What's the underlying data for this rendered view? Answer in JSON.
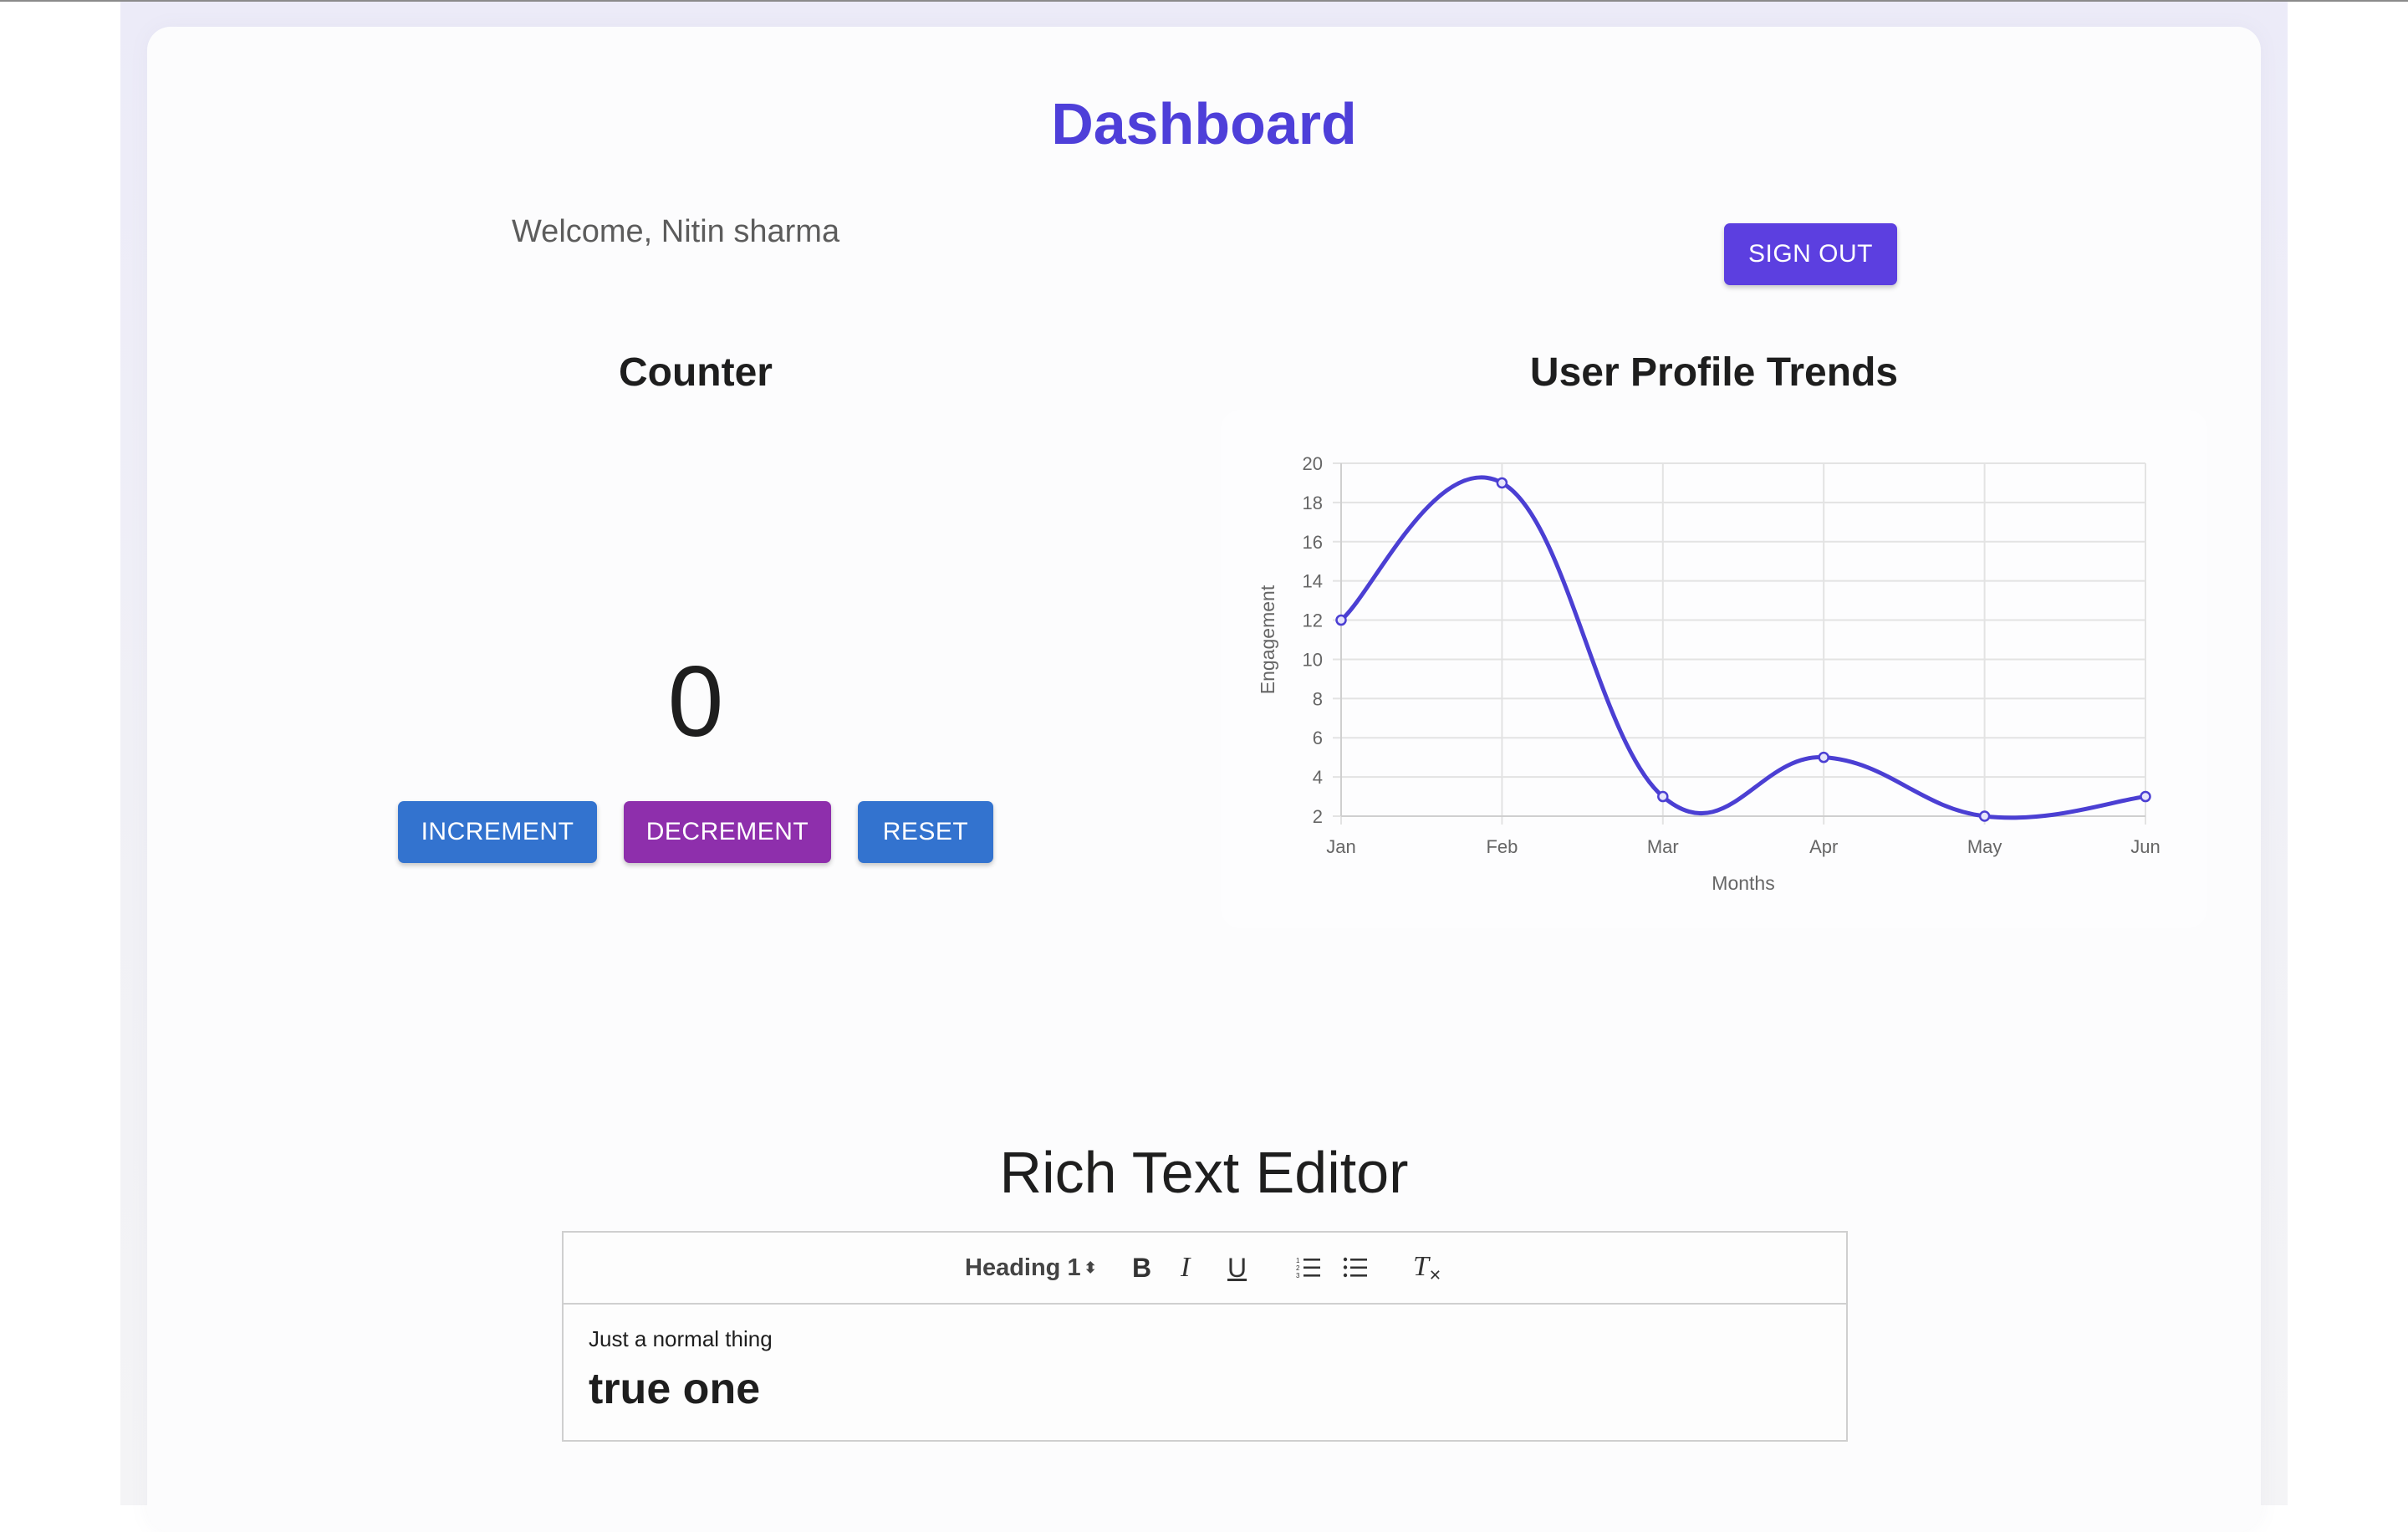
{
  "header": {
    "title": "Dashboard"
  },
  "welcome": {
    "text": "Welcome, Nitin sharma"
  },
  "buttons": {
    "sign_out": "SIGN OUT"
  },
  "counter": {
    "title": "Counter",
    "value": "0",
    "increment_label": "INCREMENT",
    "decrement_label": "DECREMENT",
    "reset_label": "RESET"
  },
  "chart_title": "User Profile Trends",
  "chart_data": {
    "type": "line",
    "categories": [
      "Jan",
      "Feb",
      "Mar",
      "Apr",
      "May",
      "Jun"
    ],
    "series": [
      {
        "values": [
          12,
          19,
          3,
          5,
          2,
          3
        ]
      }
    ],
    "xlabel": "Months",
    "ylabel": "Engagement",
    "ylim": [
      2,
      20
    ],
    "yticks": [
      "2",
      "4",
      "6",
      "8",
      "10",
      "12",
      "14",
      "16",
      "18",
      "20"
    ],
    "grid": true,
    "line_color": "#4b3fd3"
  },
  "editor": {
    "title": "Rich Text Editor",
    "heading_select": "Heading 1",
    "toolbar": {
      "bold": "B",
      "italic": "I",
      "underline": "U",
      "clear": "T"
    },
    "paragraph": "Just a normal thing",
    "heading": "true one"
  },
  "colors": {
    "brand": "#4e3fd9",
    "primary_button": "#3373cf",
    "secondary_button": "#8e2fac",
    "sign_out_button": "#5c3fe0"
  }
}
